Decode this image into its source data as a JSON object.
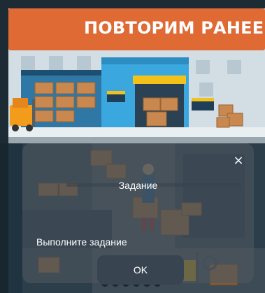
{
  "header": {
    "title": "ПОВТОРИМ РАНЕЕ"
  },
  "dialog": {
    "title": "Задание",
    "message": "Выполните задание",
    "ok_label": "OK",
    "close_glyph": "×"
  },
  "colors": {
    "header": "#e06a34",
    "wall": "#c9d7df",
    "warehouse_blue": "#3aa7df",
    "box": "#c9884f",
    "door_yellow": "#f2c21b",
    "forklift": "#f39b1a",
    "dialog": "#505860",
    "button": "#384550"
  },
  "icons": [
    "close-icon",
    "warehouse-illustration",
    "forklift-icon"
  ]
}
